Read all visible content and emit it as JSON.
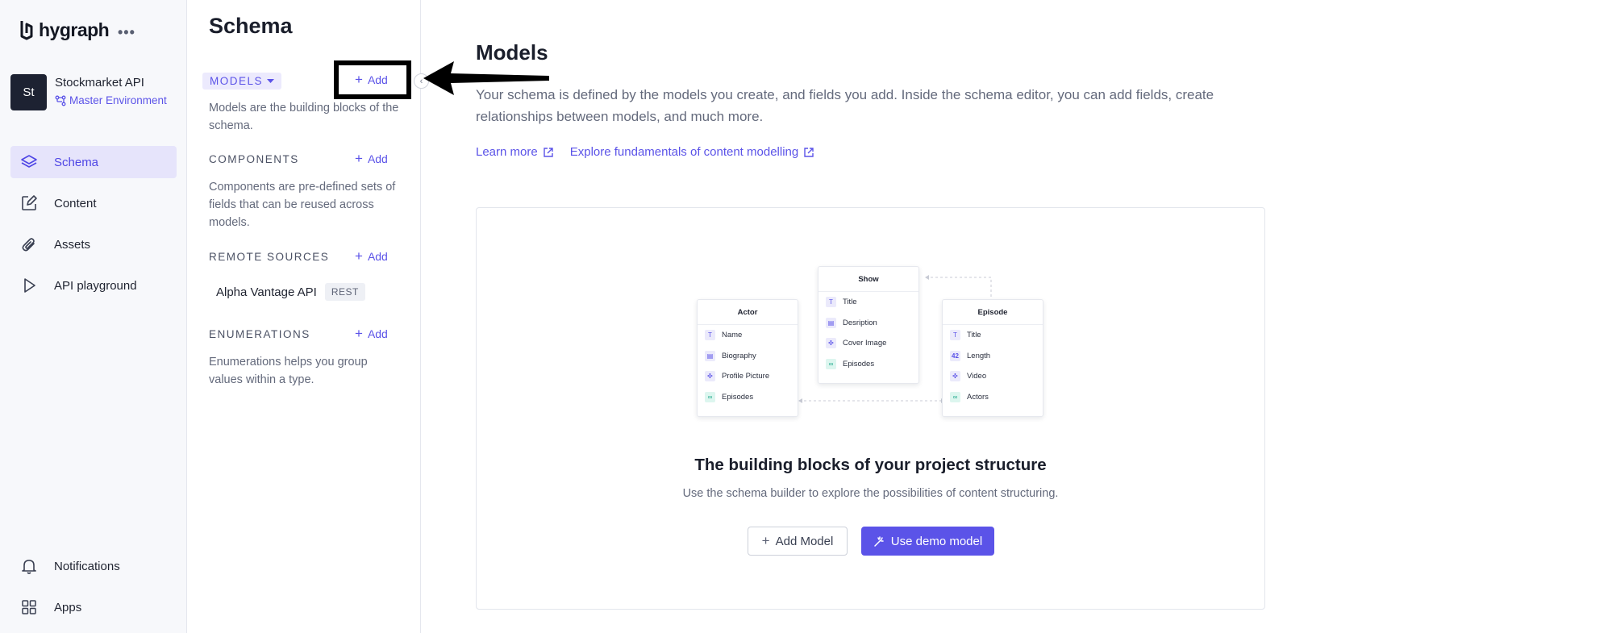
{
  "brand": {
    "logo_text": "hygraph",
    "more": "•••"
  },
  "project": {
    "avatar": "St",
    "name": "Stockmarket API",
    "environment": "Master Environment"
  },
  "nav": {
    "items": [
      {
        "label": "Schema",
        "icon": "layers-icon",
        "active": true
      },
      {
        "label": "Content",
        "icon": "edit-icon",
        "active": false
      },
      {
        "label": "Assets",
        "icon": "paperclip-icon",
        "active": false
      },
      {
        "label": "API playground",
        "icon": "play-icon",
        "active": false
      }
    ],
    "bottom": [
      {
        "label": "Notifications",
        "icon": "bell-icon"
      },
      {
        "label": "Apps",
        "icon": "apps-grid-icon"
      }
    ]
  },
  "schema": {
    "title": "Schema",
    "add_label": "Add",
    "models": {
      "label": "MODELS",
      "description": "Models are the building blocks of the schema."
    },
    "components": {
      "label": "COMPONENTS",
      "description": "Components are pre-defined sets of fields that can be reused across models."
    },
    "remote_sources": {
      "label": "REMOTE SOURCES",
      "items": [
        {
          "name": "Alpha Vantage API",
          "badge": "REST"
        }
      ]
    },
    "enumerations": {
      "label": "ENUMERATIONS",
      "description": "Enumerations helps you group values within a type."
    }
  },
  "main": {
    "title": "Models",
    "description": "Your schema is defined by the models you create, and fields you add. Inside the schema editor, you can add fields, create relationships between models, and much more.",
    "links": [
      "Learn more",
      "Explore fundamentals of content modelling"
    ],
    "card": {
      "title": "The building blocks of your project structure",
      "subtitle": "Use the schema builder to explore the possibilities of content structuring.",
      "add_model": "Add Model",
      "use_demo": "Use demo model"
    },
    "diagram": {
      "actor": {
        "title": "Actor",
        "fields": [
          "Name",
          "Biography",
          "Profile Picture",
          "Episodes"
        ]
      },
      "show": {
        "title": "Show",
        "fields": [
          "Title",
          "Desription",
          "Cover Image",
          "Episodes"
        ]
      },
      "episode": {
        "title": "Episode",
        "fields": [
          "Title",
          "Length",
          "Video",
          "Actors"
        ],
        "length_icon": "42"
      }
    }
  },
  "colors": {
    "accent": "#5b53e8",
    "active_bg": "#e6e4fb",
    "avatar_bg": "#1d2232"
  }
}
